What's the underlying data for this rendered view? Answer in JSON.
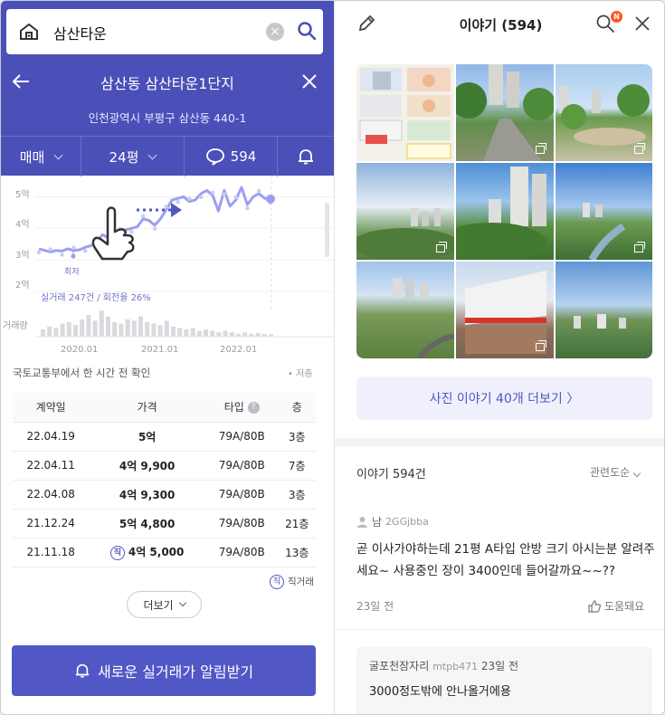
{
  "search": {
    "query": "삼산타운"
  },
  "complex": {
    "title": "삼산동 삼산타운1단지",
    "address": "인천광역시 부평구 삼산동 440-1"
  },
  "filters": {
    "trade_type": "매매",
    "size": "24평",
    "comments": "594"
  },
  "chart_data": {
    "type": "line",
    "yticks": [
      "5억",
      "4억",
      "3억",
      "2억"
    ],
    "xticks": [
      "2020.01",
      "2021.01",
      "2022.01"
    ],
    "low_label": "최저",
    "summary": "실거래 247건 / 회전율 26%",
    "volume_label": "거래량",
    "ylim": [
      2,
      5.3
    ],
    "series": [
      {
        "values": [
          3.35,
          3.3,
          3.25,
          3.3,
          3.28,
          3.35,
          3.3,
          3.32,
          3.4,
          3.45,
          3.6,
          3.8,
          3.7,
          3.85,
          3.9,
          3.95,
          4.0,
          4.05,
          4.3,
          4.25,
          4.1,
          4.3,
          4.6,
          4.9,
          4.95,
          5.0,
          4.85,
          4.9,
          5.1,
          5.2,
          5.05,
          4.55,
          5.2,
          4.7,
          4.9,
          5.3,
          4.75,
          5.0,
          5.1,
          4.95,
          4.93
        ]
      }
    ],
    "volume": [
      0.25,
      0.35,
      0.3,
      0.45,
      0.5,
      0.4,
      0.6,
      0.75,
      0.55,
      0.9,
      0.7,
      0.5,
      0.45,
      0.6,
      0.55,
      0.7,
      0.5,
      0.45,
      0.4,
      0.55,
      0.35,
      0.3,
      0.25,
      0.3,
      0.2,
      0.25,
      0.2,
      0.15,
      0.2,
      0.15,
      0.1,
      0.15,
      0.1,
      0.12,
      0.1,
      0.08
    ]
  },
  "source": {
    "text": "국토교통부에서 한 시간 전 확인",
    "legend_low": "저층"
  },
  "table": {
    "headers": {
      "date": "계약일",
      "price": "가격",
      "type": "타입",
      "type_help": "?",
      "floor": "층"
    },
    "rows": [
      {
        "date": "22.04.19",
        "price": "5억",
        "type": "79A/80B",
        "floor": "3층",
        "direct": ""
      },
      {
        "date": "22.04.11",
        "price": "4억 9,900",
        "type": "79A/80B",
        "floor": "7층",
        "direct": ""
      },
      {
        "date": "22.04.08",
        "price": "4억 9,300",
        "type": "79A/80B",
        "floor": "3층",
        "direct": ""
      },
      {
        "date": "21.12.24",
        "price": "5억 4,800",
        "type": "79A/80B",
        "floor": "21층",
        "direct": ""
      },
      {
        "date": "21.11.18",
        "price": "4억 5,000",
        "type": "79A/80B",
        "floor": "13층",
        "direct": "직"
      }
    ],
    "direct_mark": "직",
    "direct_legend": "직거래"
  },
  "more_button": "더보기",
  "alert_button": "새로운 실거래가 알림받기",
  "right": {
    "title": "이야기 (594)",
    "badge": "N",
    "photo_more": "사진 이야기 40개 더보기 〉",
    "stories_count": "이야기 594건",
    "sort": "관련도순",
    "post": {
      "gender": "남",
      "nick": "2GGjbba",
      "text": "곧 이사가야하는데 21평 A타입 안방 크기 아시는분 알려주세요~ 사용중인 장이 3400인데 들어갈까요~~??",
      "date": "23일 전",
      "helpful": "도움돼요"
    },
    "reply": {
      "name": "굴포천잠자리",
      "nick": "mtpb471",
      "date": "23일 전",
      "text": "3000정도밖에 안나올거에용"
    }
  },
  "colors": {
    "brand": "#4b4fb8",
    "button": "#5257c6",
    "accent": "#6f73c8"
  }
}
